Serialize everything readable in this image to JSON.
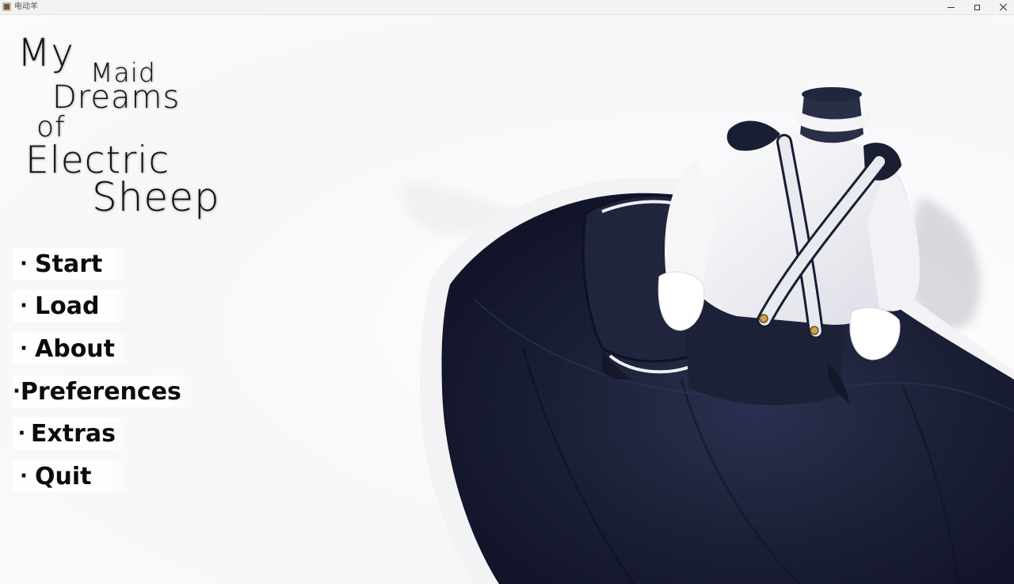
{
  "window": {
    "title": "电动羊",
    "icon": "app-icon",
    "controls": [
      "minimize-icon",
      "maximize-icon",
      "close-icon"
    ]
  },
  "logo": {
    "lines": [
      "My",
      "Maid",
      "Dreams",
      "of",
      "Electric",
      "Sheep"
    ]
  },
  "menu": {
    "bullet": "·",
    "items": [
      {
        "label": "Start"
      },
      {
        "label": "Load"
      },
      {
        "label": "About"
      },
      {
        "label": "Preferences"
      },
      {
        "label": "Extras"
      },
      {
        "label": "Quit"
      }
    ]
  },
  "colors": {
    "background": "#ffffff",
    "dress_navy": "#1b1f33",
    "text": "#0c0c0c"
  }
}
